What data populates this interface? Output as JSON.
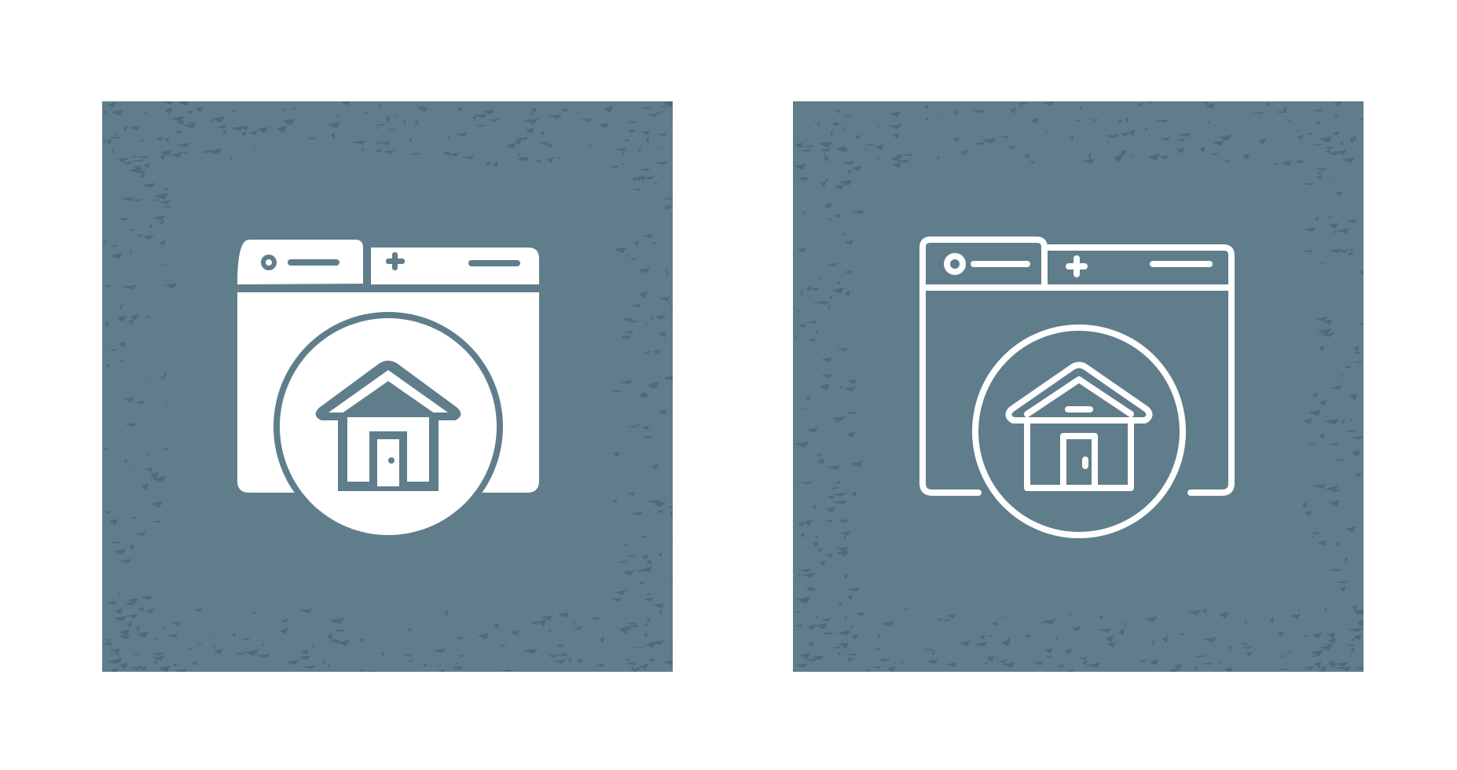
{
  "icons": [
    {
      "name": "browser-home-icon",
      "style": "glyph",
      "variant": "filled"
    },
    {
      "name": "browser-home-icon",
      "style": "line",
      "variant": "outline"
    }
  ],
  "colors": {
    "background": "#ffffff",
    "tile": "#607d8b",
    "speckle": "#4f6a78",
    "icon": "#ffffff"
  }
}
